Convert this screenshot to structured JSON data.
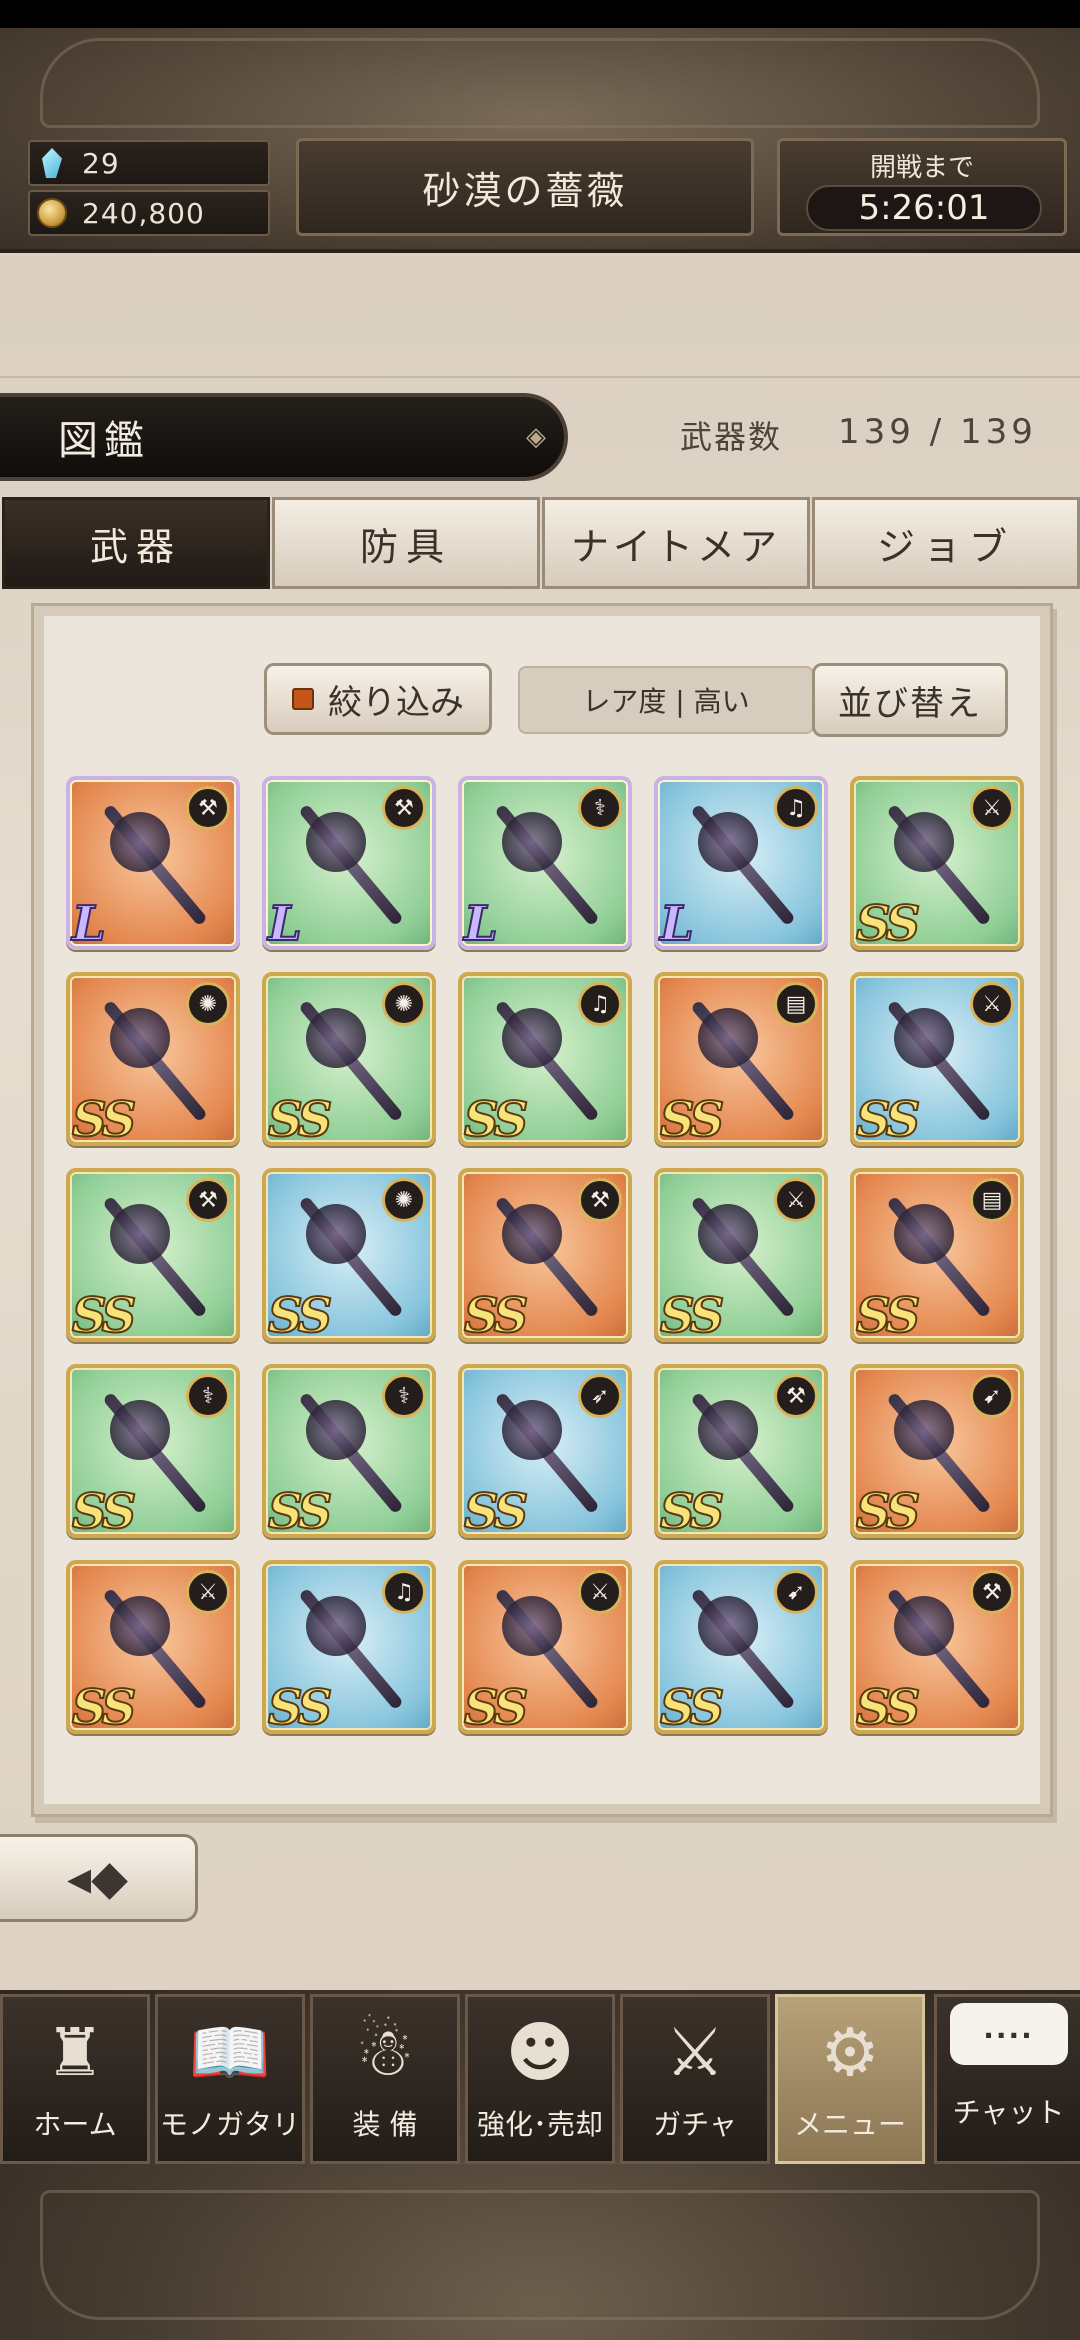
{
  "header": {
    "crystal_count": "29",
    "coin_count": "240,800",
    "title": "砂漠の薔薇",
    "timer_label": "開戦まで",
    "timer": "5:26:01"
  },
  "collection": {
    "title": "図鑑",
    "count_label": "武器数",
    "count_value": "139 / 139"
  },
  "tabs": [
    {
      "label": "武器",
      "active": true
    },
    {
      "label": "防具",
      "active": false
    },
    {
      "label": "ナイトメア",
      "active": false
    },
    {
      "label": "ジョブ",
      "active": false
    }
  ],
  "controls": {
    "filter_label": "絞り込み",
    "sort_status": "レア度 | 高い",
    "sort_label": "並び替え"
  },
  "weapons": [
    {
      "rarity": "L",
      "bg": "orange",
      "icon": "hammer-icon"
    },
    {
      "rarity": "L",
      "bg": "green",
      "icon": "hammer-icon"
    },
    {
      "rarity": "L",
      "bg": "green",
      "icon": "staff-icon"
    },
    {
      "rarity": "L",
      "bg": "blue",
      "icon": "harp-icon"
    },
    {
      "rarity": "SS",
      "bg": "green",
      "icon": "sword-icon"
    },
    {
      "rarity": "SS",
      "bg": "orange",
      "icon": "tome-icon"
    },
    {
      "rarity": "SS",
      "bg": "green",
      "icon": "tome-icon"
    },
    {
      "rarity": "SS",
      "bg": "green",
      "icon": "harp-icon"
    },
    {
      "rarity": "SS",
      "bg": "orange",
      "icon": "book-icon"
    },
    {
      "rarity": "SS",
      "bg": "blue",
      "icon": "sword-icon"
    },
    {
      "rarity": "SS",
      "bg": "green",
      "icon": "hammer-icon"
    },
    {
      "rarity": "SS",
      "bg": "blue",
      "icon": "tome-icon"
    },
    {
      "rarity": "SS",
      "bg": "orange",
      "icon": "hammer-icon"
    },
    {
      "rarity": "SS",
      "bg": "green",
      "icon": "sword-icon"
    },
    {
      "rarity": "SS",
      "bg": "orange",
      "icon": "book-icon"
    },
    {
      "rarity": "SS",
      "bg": "green",
      "icon": "staff-icon"
    },
    {
      "rarity": "SS",
      "bg": "green",
      "icon": "staff-icon"
    },
    {
      "rarity": "SS",
      "bg": "blue",
      "icon": "spear-icon"
    },
    {
      "rarity": "SS",
      "bg": "green",
      "icon": "hammer-icon"
    },
    {
      "rarity": "SS",
      "bg": "orange",
      "icon": "bow-icon"
    },
    {
      "rarity": "SS",
      "bg": "orange",
      "icon": "sword-icon"
    },
    {
      "rarity": "SS",
      "bg": "blue",
      "icon": "harp-icon"
    },
    {
      "rarity": "SS",
      "bg": "orange",
      "icon": "sword-icon"
    },
    {
      "rarity": "SS",
      "bg": "blue",
      "icon": "bow-icon"
    },
    {
      "rarity": "SS",
      "bg": "orange",
      "icon": "hammer-icon"
    }
  ],
  "nav": [
    {
      "label": "ホーム",
      "icon": "castle-icon",
      "glyph": "♜",
      "active": false
    },
    {
      "label": "モノガタリ",
      "icon": "book-icon",
      "glyph": "📖",
      "active": false
    },
    {
      "label": "装 備",
      "icon": "puppet-icon",
      "glyph": "☃",
      "active": false
    },
    {
      "label": "強化･売却",
      "icon": "mask-icon",
      "glyph": "☻",
      "active": false
    },
    {
      "label": "ガチャ",
      "icon": "crossed-swords-icon",
      "glyph": "⚔",
      "active": false
    },
    {
      "label": "メニュー",
      "icon": "gears-icon",
      "glyph": "⚙",
      "active": true
    }
  ],
  "chat": {
    "bubble": "....",
    "label": "チャット"
  },
  "colors": {
    "accent_gold": "#cda84f",
    "dark_panel": "#201a15",
    "parchment": "#e6ddd0"
  }
}
